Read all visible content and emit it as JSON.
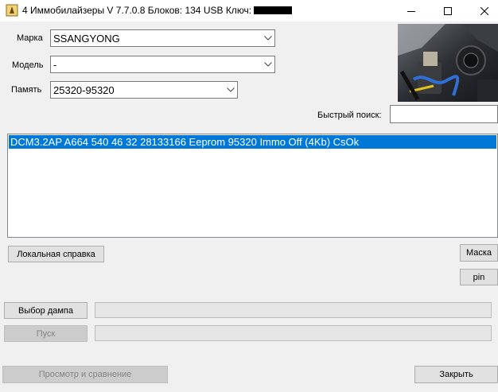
{
  "window": {
    "title": "4 Иммобилайзеры V 7.7.0.8   Блоков: 134  USB Ключ:",
    "controls": {
      "minimize": "minimize-icon",
      "maximize": "maximize-icon",
      "close": "close-icon"
    }
  },
  "form": {
    "brand": {
      "label": "Марка",
      "value": "SSANGYONG"
    },
    "model": {
      "label": "Модель",
      "value": "-"
    },
    "memory": {
      "label": "Память",
      "value": "25320-95320"
    },
    "quick_search": {
      "label": "Быстрый поиск:",
      "value": ""
    }
  },
  "list": {
    "items": [
      "DCM3.2AP A664 540 46 32 28133166 Eeprom 95320 Immo Off (4Kb) CsOk"
    ],
    "selected_index": 0
  },
  "buttons": {
    "local_help": "Локальная справка",
    "mask": "Маска",
    "pin": "pin",
    "select_dump": "Выбор дампа",
    "start": "Пуск",
    "view_compare": "Просмотр и сравнение",
    "close": "Закрыть"
  },
  "progress": {
    "dump": 0,
    "start": 0
  },
  "colors": {
    "selection": "#0078d7",
    "window_bg": "#f0f0f0",
    "titlebar_bg": "#ffffff"
  }
}
